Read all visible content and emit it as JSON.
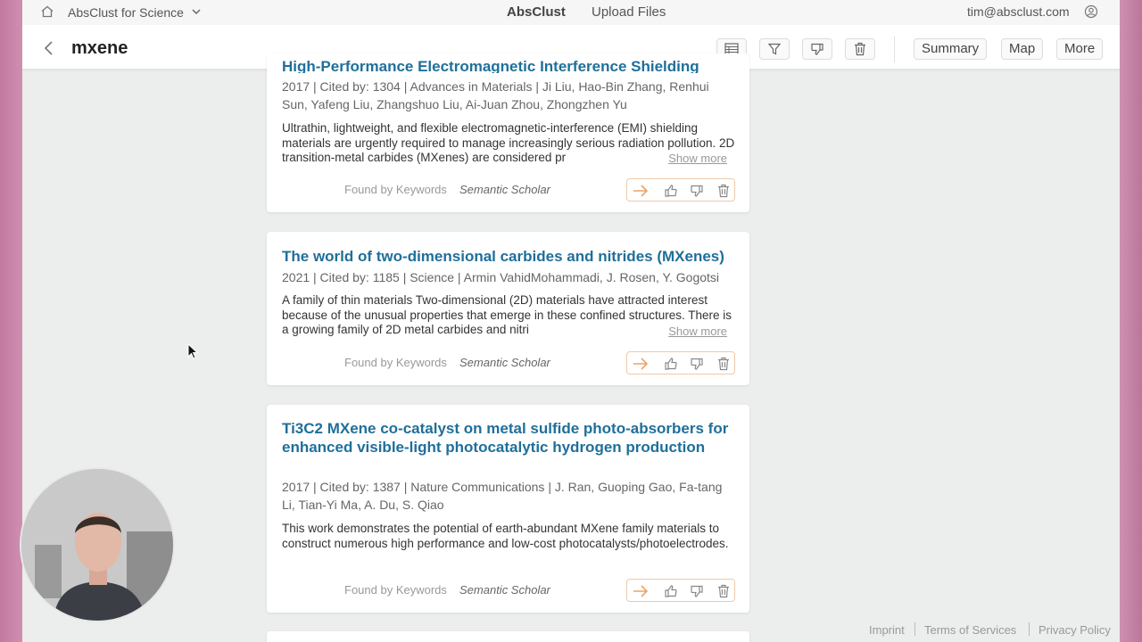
{
  "topbar": {
    "brand": "AbsClust for Science",
    "center_title": "AbsClust",
    "upload": "Upload Files",
    "email": "tim@absclust.com"
  },
  "toolbar": {
    "query": "mxene",
    "buttons": [
      "Summary",
      "Map",
      "More"
    ]
  },
  "cards": [
    {
      "title": "High-Performance Electromagnetic Interference Shielding",
      "meta": "2017 | Cited by: 1304 | Advances in Materials | Ji Liu, Hao-Bin Zhang, Renhui Sun, Yafeng Liu, Zhangshuo Liu, Ai-Juan Zhou, Zhongzhen Yu",
      "abstract": "Ultrathin, lightweight, and flexible electromagnetic-interference (EMI) shielding materials are urgently required to manage increasingly serious radiation pollution. 2D transition-metal carbides (MXenes) are considered pr",
      "show_more": "Show more",
      "found": "Found by Keywords",
      "source": "Semantic Scholar"
    },
    {
      "title": "The world of two-dimensional carbides and nitrides (MXenes)",
      "meta": "2021 | Cited by: 1185 | Science | Armin VahidMohammadi, J. Rosen, Y. Gogotsi",
      "abstract": "A family of thin materials Two-dimensional (2D) materials have attracted interest because of the unusual properties that emerge in these confined structures. There is a growing family of 2D metal carbides and nitri",
      "show_more": "Show more",
      "found": "Found by Keywords",
      "source": "Semantic Scholar"
    },
    {
      "title": "Ti3C2 MXene co-catalyst on metal sulfide photo-absorbers for enhanced visible-light photocatalytic hydrogen production",
      "meta": "2017 | Cited by: 1387 | Nature Communications | J. Ran, Guoping Gao, Fa-tang Li, Tian-Yi Ma, A. Du, S. Qiao",
      "abstract": "This work demonstrates the potential of earth-abundant MXene family materials to construct numerous high performance and low-cost photocatalysts/photoelectrodes.",
      "found": "Found by Keywords",
      "source": "Semantic Scholar"
    }
  ],
  "footer": {
    "imprint": "Imprint",
    "terms": "Terms of Services",
    "privacy": "Privacy Policy"
  },
  "colors": {
    "title_blue": "#1f6f9a",
    "action_orange": "#e8a46a"
  }
}
